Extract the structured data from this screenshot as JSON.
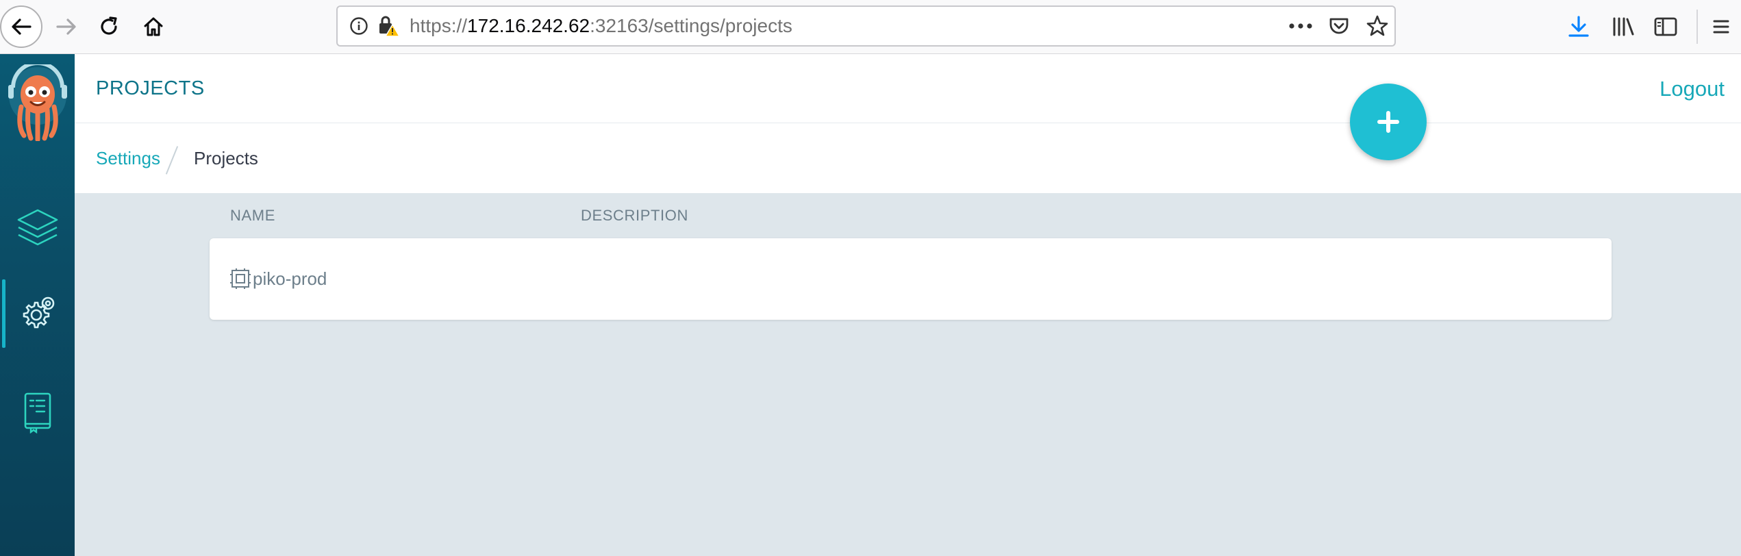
{
  "browser": {
    "url_prefix": "https://",
    "url_host": "172.16.242.62",
    "url_rest": ":32163/settings/projects"
  },
  "icons": {
    "back": "arrow-left-icon",
    "forward": "arrow-right-icon",
    "reload": "reload-icon",
    "home": "home-icon",
    "info": "info-icon",
    "insecure": "lock-warning-icon",
    "page_actions": "more-dots-icon",
    "pocket": "pocket-icon",
    "bookmark": "star-icon",
    "downloads": "download-icon",
    "library": "library-icon",
    "sidebar": "sidebar-icon",
    "menu": "hamburger-icon",
    "argo_logo": "argo-octopus-logo",
    "applications": "layers-icon",
    "settings": "gear-icon",
    "docs": "book-icon",
    "add": "plus-icon",
    "project": "project-icon"
  },
  "colors": {
    "accent": "#17a8b8",
    "title": "#0e7489",
    "fab": "#1fbfd3",
    "sidebar": "#0b4d66",
    "content_bg": "#dee6eb"
  },
  "header": {
    "title": "PROJECTS",
    "logout": "Logout"
  },
  "breadcrumbs": {
    "parent": "Settings",
    "current": "Projects"
  },
  "table": {
    "columns": [
      "NAME",
      "DESCRIPTION"
    ],
    "rows": [
      {
        "name": "piko-prod",
        "description": ""
      }
    ]
  }
}
